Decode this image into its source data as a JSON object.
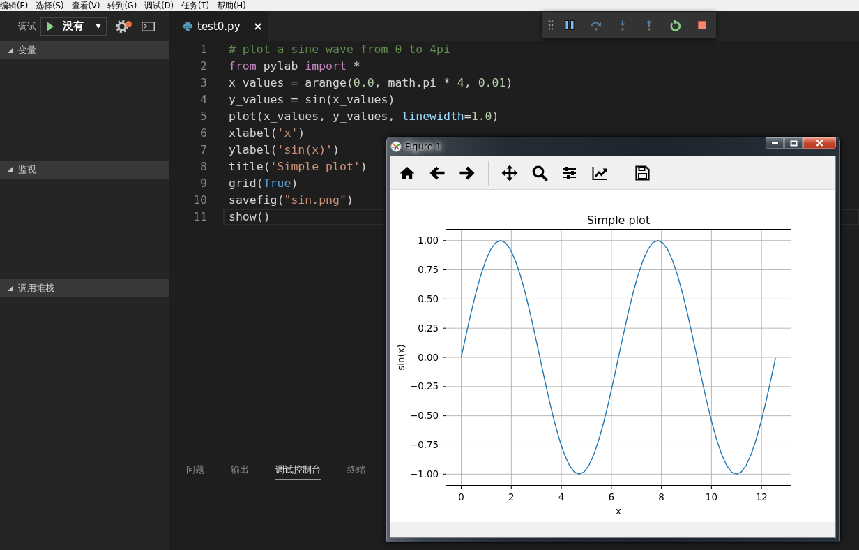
{
  "menu_bar": {
    "items": [
      "编辑(E)",
      "选择(S)",
      "查看(V)",
      "转到(G)",
      "调试(D)",
      "任务(T)",
      "帮助(H)"
    ]
  },
  "debug_sidebar": {
    "label": "调试",
    "config": "没有",
    "settings_badge": true,
    "sections": [
      {
        "title": "变量",
        "expanded": true
      },
      {
        "title": "监视",
        "expanded": true
      },
      {
        "title": "调用堆栈",
        "expanded": true
      }
    ]
  },
  "editor": {
    "tabs": [
      {
        "label": "test0.py",
        "selected": true
      }
    ],
    "lines": [
      {
        "number": "1",
        "current": false,
        "tokens": [
          {
            "kind": "comment",
            "text": "# plot a sine wave from 0 to 4pi"
          }
        ]
      },
      {
        "number": "2",
        "current": false,
        "tokens": [
          {
            "kind": "keyword",
            "text": "from"
          },
          {
            "kind": "plain",
            "text": " pylab "
          },
          {
            "kind": "keyword",
            "text": "import"
          },
          {
            "kind": "plain",
            "text": " *"
          }
        ]
      },
      {
        "number": "3",
        "current": false,
        "tokens": [
          {
            "kind": "plain",
            "text": "x_values = arange("
          },
          {
            "kind": "number",
            "text": "0.0"
          },
          {
            "kind": "plain",
            "text": ", math.pi * "
          },
          {
            "kind": "number",
            "text": "4"
          },
          {
            "kind": "plain",
            "text": ", "
          },
          {
            "kind": "number",
            "text": "0.01"
          },
          {
            "kind": "plain",
            "text": ")"
          }
        ]
      },
      {
        "number": "4",
        "current": false,
        "tokens": [
          {
            "kind": "plain",
            "text": "y_values = sin(x_values)"
          }
        ]
      },
      {
        "number": "5",
        "current": false,
        "tokens": [
          {
            "kind": "plain",
            "text": "plot(x_values, y_values, "
          },
          {
            "kind": "param",
            "text": "linewidth"
          },
          {
            "kind": "plain",
            "text": "="
          },
          {
            "kind": "number",
            "text": "1.0"
          },
          {
            "kind": "plain",
            "text": ")"
          }
        ]
      },
      {
        "number": "6",
        "current": false,
        "tokens": [
          {
            "kind": "plain",
            "text": "xlabel("
          },
          {
            "kind": "string",
            "text": "'x'"
          },
          {
            "kind": "plain",
            "text": ")"
          }
        ]
      },
      {
        "number": "7",
        "current": false,
        "tokens": [
          {
            "kind": "plain",
            "text": "ylabel("
          },
          {
            "kind": "string",
            "text": "'sin(x)'"
          },
          {
            "kind": "plain",
            "text": ")"
          }
        ]
      },
      {
        "number": "8",
        "current": false,
        "tokens": [
          {
            "kind": "plain",
            "text": "title("
          },
          {
            "kind": "string",
            "text": "'Simple plot'"
          },
          {
            "kind": "plain",
            "text": ")"
          }
        ]
      },
      {
        "number": "9",
        "current": false,
        "tokens": [
          {
            "kind": "plain",
            "text": "grid("
          },
          {
            "kind": "constant",
            "text": "True"
          },
          {
            "kind": "plain",
            "text": ")"
          }
        ]
      },
      {
        "number": "10",
        "current": false,
        "tokens": [
          {
            "kind": "plain",
            "text": "savefig("
          },
          {
            "kind": "string",
            "text": "\"sin.png\""
          },
          {
            "kind": "plain",
            "text": ")"
          }
        ]
      },
      {
        "number": "11",
        "current": true,
        "tokens": [
          {
            "kind": "plain",
            "text": "show()"
          }
        ]
      }
    ]
  },
  "debug_toolbar": {
    "pause": {
      "disabled": false
    },
    "step_over": {
      "disabled": true
    },
    "step_into": {
      "disabled": true
    },
    "step_out": {
      "disabled": true
    },
    "restart": {
      "disabled": false
    },
    "stop": {
      "disabled": false
    }
  },
  "panel": {
    "tabs": [
      {
        "label": "问题",
        "selected": false
      },
      {
        "label": "输出",
        "selected": false
      },
      {
        "label": "调试控制台",
        "selected": true
      },
      {
        "label": "终端",
        "selected": false
      }
    ]
  },
  "figure_window": {
    "title": "Figure 1",
    "chart_data": {
      "type": "line",
      "title": "Simple plot",
      "xlabel": "x",
      "ylabel": "sin(x)",
      "grid": true,
      "x": [
        0,
        0.196,
        0.393,
        0.589,
        0.785,
        0.982,
        1.178,
        1.374,
        1.571,
        1.767,
        1.963,
        2.16,
        2.356,
        2.553,
        2.749,
        2.945,
        3.142,
        3.338,
        3.534,
        3.731,
        3.927,
        4.123,
        4.32,
        4.516,
        4.712,
        4.909,
        5.105,
        5.301,
        5.498,
        5.694,
        5.89,
        6.087,
        6.283,
        6.48,
        6.676,
        6.872,
        7.069,
        7.265,
        7.461,
        7.658,
        7.854,
        8.05,
        8.247,
        8.443,
        8.639,
        8.836,
        9.032,
        9.228,
        9.425,
        9.621,
        9.817,
        10.014,
        10.21,
        10.407,
        10.603,
        10.799,
        10.996,
        11.192,
        11.388,
        11.585,
        11.781,
        11.977,
        12.174,
        12.37,
        12.56
      ],
      "series": [
        {
          "color": "#1f77b4",
          "values": [
            0,
            0.195,
            0.383,
            0.556,
            0.707,
            0.831,
            0.924,
            0.981,
            1,
            0.981,
            0.924,
            0.831,
            0.707,
            0.556,
            0.383,
            0.195,
            0,
            -0.195,
            -0.383,
            -0.556,
            -0.707,
            -0.831,
            -0.924,
            -0.981,
            -1,
            -0.981,
            -0.924,
            -0.831,
            -0.707,
            -0.556,
            -0.383,
            -0.195,
            0,
            0.195,
            0.383,
            0.556,
            0.707,
            0.831,
            0.924,
            0.981,
            1,
            0.981,
            0.924,
            0.831,
            0.707,
            0.556,
            0.383,
            0.195,
            0,
            -0.195,
            -0.383,
            -0.556,
            -0.707,
            -0.831,
            -0.924,
            -0.981,
            -1,
            -0.981,
            -0.924,
            -0.831,
            -0.707,
            -0.556,
            -0.383,
            -0.195,
            -0.006
          ]
        }
      ],
      "xlim": [
        -0.628,
        13.194
      ],
      "ylim": [
        -1.1,
        1.1
      ],
      "xticks": [
        0,
        2,
        4,
        6,
        8,
        10,
        12
      ],
      "yticks": [
        {
          "value": -1,
          "label": "−1.00"
        },
        {
          "value": -0.75,
          "label": "−0.75"
        },
        {
          "value": -0.5,
          "label": "−0.50"
        },
        {
          "value": -0.25,
          "label": "−0.25"
        },
        {
          "value": 0,
          "label": "0.00"
        },
        {
          "value": 0.25,
          "label": "0.25"
        },
        {
          "value": 0.5,
          "label": "0.50"
        },
        {
          "value": 0.75,
          "label": "0.75"
        },
        {
          "value": 1,
          "label": "1.00"
        }
      ]
    }
  }
}
